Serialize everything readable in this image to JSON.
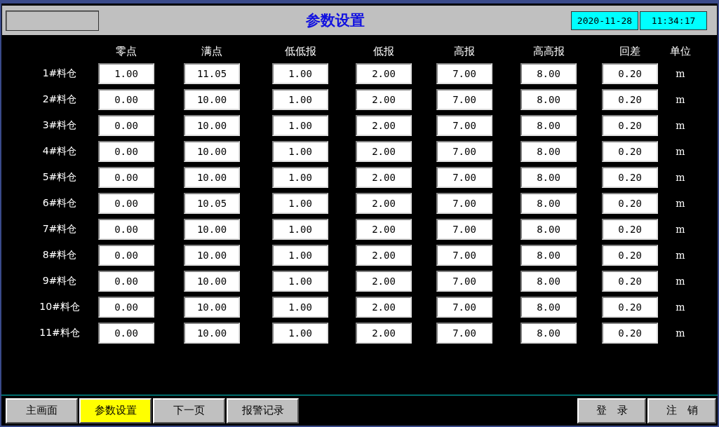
{
  "header": {
    "title": "参数设置",
    "date": "2020-11-28",
    "time": "11:34:17"
  },
  "columns": [
    "零点",
    "满点",
    "低低报",
    "低报",
    "高报",
    "高高报",
    "回差"
  ],
  "unit_header": "单位",
  "rows": [
    {
      "label": "1#料仓",
      "values": [
        "1.00",
        "11.05",
        "1.00",
        "2.00",
        "7.00",
        "8.00",
        "0.20"
      ],
      "unit": "m"
    },
    {
      "label": "2#料仓",
      "values": [
        "0.00",
        "10.00",
        "1.00",
        "2.00",
        "7.00",
        "8.00",
        "0.20"
      ],
      "unit": "m"
    },
    {
      "label": "3#料仓",
      "values": [
        "0.00",
        "10.00",
        "1.00",
        "2.00",
        "7.00",
        "8.00",
        "0.20"
      ],
      "unit": "m"
    },
    {
      "label": "4#料仓",
      "values": [
        "0.00",
        "10.00",
        "1.00",
        "2.00",
        "7.00",
        "8.00",
        "0.20"
      ],
      "unit": "m"
    },
    {
      "label": "5#料仓",
      "values": [
        "0.00",
        "10.00",
        "1.00",
        "2.00",
        "7.00",
        "8.00",
        "0.20"
      ],
      "unit": "m"
    },
    {
      "label": "6#料仓",
      "values": [
        "0.00",
        "10.05",
        "1.00",
        "2.00",
        "7.00",
        "8.00",
        "0.20"
      ],
      "unit": "m"
    },
    {
      "label": "7#料仓",
      "values": [
        "0.00",
        "10.00",
        "1.00",
        "2.00",
        "7.00",
        "8.00",
        "0.20"
      ],
      "unit": "m"
    },
    {
      "label": "8#料仓",
      "values": [
        "0.00",
        "10.00",
        "1.00",
        "2.00",
        "7.00",
        "8.00",
        "0.20"
      ],
      "unit": "m"
    },
    {
      "label": "9#料仓",
      "values": [
        "0.00",
        "10.00",
        "1.00",
        "2.00",
        "7.00",
        "8.00",
        "0.20"
      ],
      "unit": "m"
    },
    {
      "label": "10#料仓",
      "values": [
        "0.00",
        "10.00",
        "1.00",
        "2.00",
        "7.00",
        "8.00",
        "0.20"
      ],
      "unit": "m"
    },
    {
      "label": "11#料仓",
      "values": [
        "0.00",
        "10.00",
        "1.00",
        "2.00",
        "7.00",
        "8.00",
        "0.20"
      ],
      "unit": "m"
    }
  ],
  "nav": [
    {
      "label": "主画面",
      "selected": false
    },
    {
      "label": "参数设置",
      "selected": true
    },
    {
      "label": "下一页",
      "selected": false
    },
    {
      "label": "报警记录",
      "selected": false
    }
  ],
  "actions": [
    "登　录",
    "注　销"
  ]
}
